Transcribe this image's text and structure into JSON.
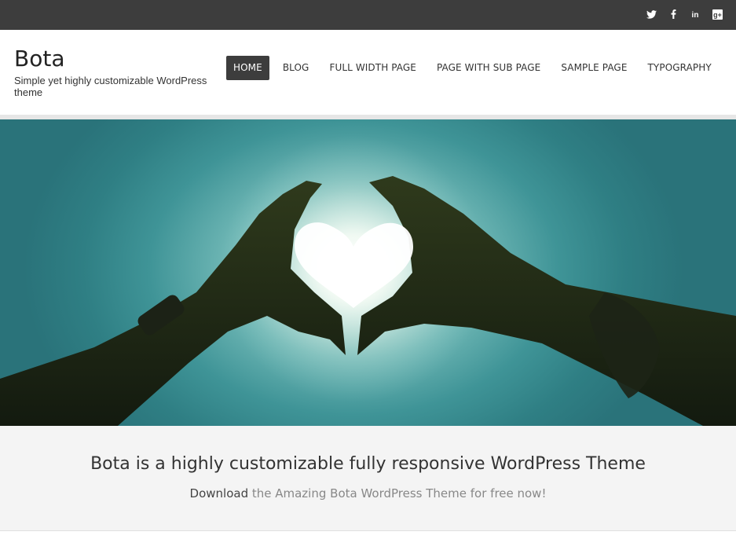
{
  "colors": {
    "topbar": "#3d3d3d",
    "nav_active_bg": "#3d3d3d",
    "nav_active_fg": "#ffffff",
    "cta_bg": "#f4f4f4",
    "sky": "#3f9497"
  },
  "social": [
    {
      "name": "twitter-icon"
    },
    {
      "name": "facebook-icon"
    },
    {
      "name": "linkedin-icon",
      "glyph": "in"
    },
    {
      "name": "google-plus-icon",
      "glyph": "g+"
    }
  ],
  "site": {
    "title": "Bota",
    "tagline": "Simple yet highly customizable WordPress theme"
  },
  "nav": {
    "items": [
      {
        "label": "HOME",
        "active": true
      },
      {
        "label": "BLOG"
      },
      {
        "label": "FULL WIDTH PAGE"
      },
      {
        "label": "PAGE WITH SUB PAGE"
      },
      {
        "label": "SAMPLE PAGE"
      },
      {
        "label": "TYPOGRAPHY"
      }
    ]
  },
  "hero": {
    "image": "silhouette of two hands forming a heart against the sun in a teal sky"
  },
  "cta": {
    "title": "Bota is a highly customizable fully responsive WordPress Theme",
    "download_link": "Download",
    "rest": " the Amazing Bota WordPress Theme for free now!"
  }
}
